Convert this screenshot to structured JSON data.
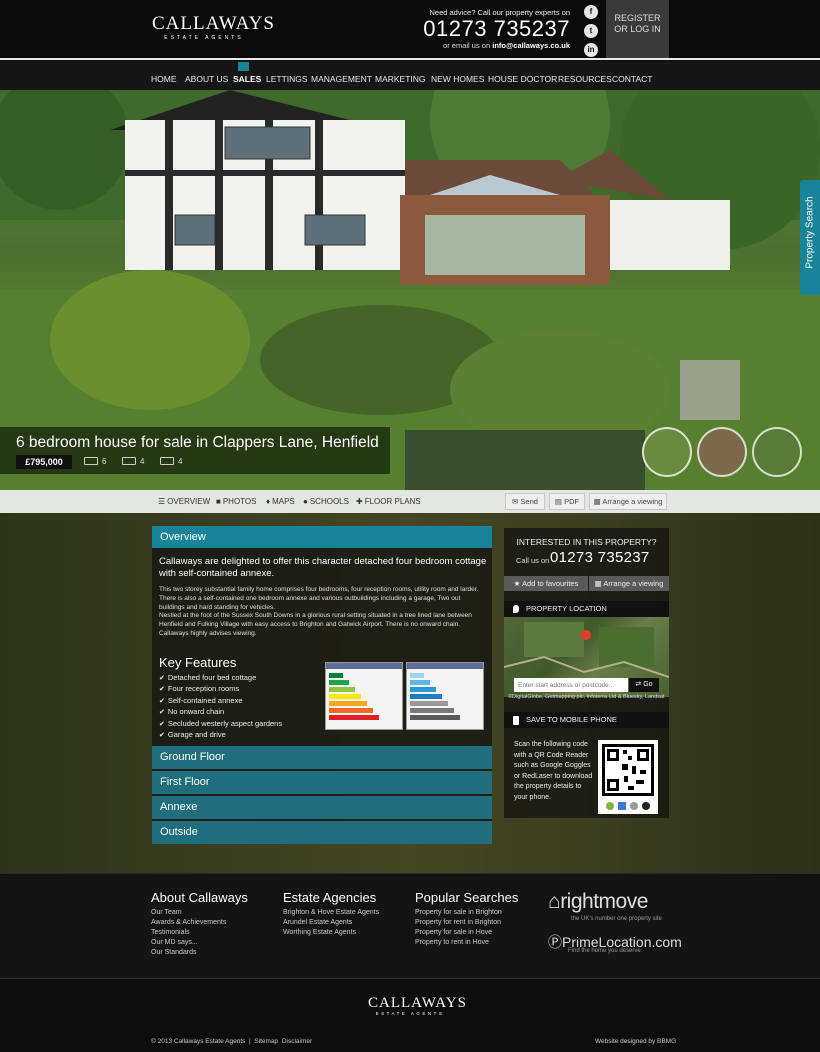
{
  "header": {
    "logo_text": "CALLAWAYS",
    "logo_sub": "ESTATE AGENTS",
    "advice": "Need advice? Call our property experts on",
    "phone": "01273 735237",
    "email_prefix": "or email us on",
    "email": "info@callaways.co.uk",
    "register_line1": "REGISTER",
    "register_line2": "OR LOG IN",
    "social": [
      "f",
      "t",
      "in"
    ]
  },
  "nav": {
    "items": [
      "HOME",
      "ABOUT US",
      "SALES",
      "LETTINGS",
      "MANAGEMENT",
      "MARKETING",
      "NEW HOMES",
      "HOUSE DOCTOR",
      "RESOURCES",
      "CONTACT"
    ],
    "active": "SALES"
  },
  "listing": {
    "title": "6 bedroom house for sale in Clappers Lane, Henfield",
    "price": "£795,000",
    "bedrooms": "6",
    "bathrooms": "4",
    "receptions": "4",
    "property_search": "Property Search"
  },
  "tabs": {
    "overview": "OVERVIEW",
    "photos": "PHOTOS",
    "maps": "MAPS",
    "schools": "SCHOOLS",
    "floor_plans": "FLOOR PLANS",
    "send": "Send",
    "pdf": "PDF",
    "arrange": "Arrange a viewing"
  },
  "overview": {
    "heading": "Overview",
    "lead": "Callaways are delighted to offer this character detached four bedroom cottage with self-contained annexe.",
    "body1": "This two storey substantial family home comprises four bedrooms, four reception rooms, utility room and larder. There is also a self-contained one bedroom annexe and various outbuildings including a garage, Two out buildings and hard standing for vehicles.",
    "body2": "Nestled at the foot of the Sussex South Downs in a glorious rural setting situated in a tree lined lane between Henfield and Fulking Village with easy access to Brighton and Gatwick Airport. There is no onward chain. Callaways highly advises viewing.",
    "key_features_title": "Key Features",
    "key_features": [
      "Detached four bed cottage",
      "Four reception rooms",
      "Self-contained annexe",
      "No onward chain",
      "Secluded westerly aspect gardens",
      "Garage and drive"
    ],
    "accordion": [
      "Ground Floor",
      "First Floor",
      "Annexe",
      "Outside"
    ]
  },
  "sidebar": {
    "interested": "INTERESTED IN THIS PROPERTY?",
    "call_us": "Call us on",
    "phone": "01273 735237",
    "add_favourites": "Add to favourites",
    "arrange_viewing": "Arrange a viewing",
    "location_title": "PROPERTY LOCATION",
    "map_placeholder": "Enter start address or postcode...",
    "go": "Go",
    "map_attrib": "©DigitalGlobe, Getmapping plc, Infoterra Ltd & Bluesky, Landsat",
    "mobile_title": "SAVE TO MOBILE PHONE",
    "qr_text": "Scan the following code with a QR Code Reader such as Google Goggles or RedLaser to download the property details to your phone."
  },
  "footer": {
    "about_title": "About Callaways",
    "about_links": [
      "Our Team",
      "Awards & Achievements",
      "Testimonials",
      "Our MD says...",
      "Our Standards"
    ],
    "agencies_title": "Estate Agencies",
    "agencies_links": [
      "Brighton & Hove Estate Agents",
      "Arundel Estate Agents",
      "Worthing Estate Agents"
    ],
    "popular_title": "Popular Searches",
    "popular_links": [
      "Property for sale in Brighton",
      "Property for rent in Brighton",
      "Property for sale in Hove",
      "Property to rent in Hove"
    ],
    "rightmove": "rightmove",
    "rightmove_tag": "the UK's number one property site",
    "primelocation": "PrimeLocation.com",
    "primelocation_tag": "Find the home you deserve",
    "copyright": "© 2013 Callaways Estate Agents",
    "sitemap": "Sitemap",
    "disclaimer": "Disclaimer",
    "designed": "Website designed by BBMG"
  },
  "colors": {
    "accent": "#19839a",
    "dark": "#0b0b0b",
    "accordion": "#1f6d7d"
  }
}
